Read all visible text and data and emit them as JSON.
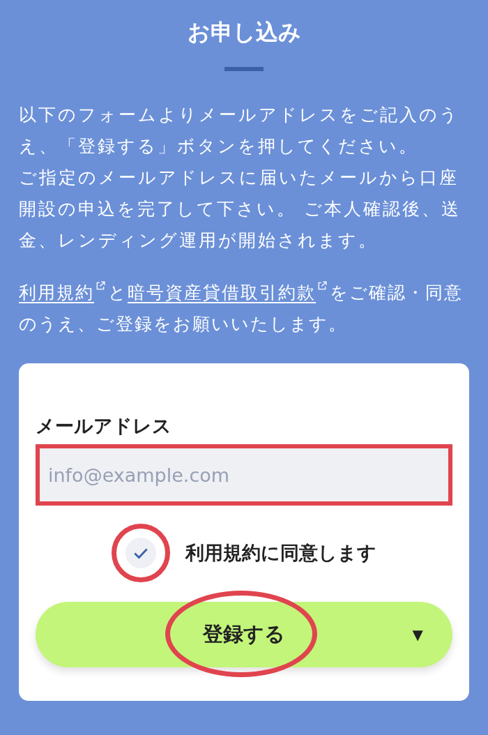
{
  "title": "お申し込み",
  "intro": [
    "以下のフォームよりメールアドレスをご記入のうえ、「登録する」ボタンを押してください。",
    "ご指定のメールアドレスに届いたメールから口座開設の申込を完了して下さい。 ご本人確認後、送金、レンディング運用が開始されます。"
  ],
  "terms": [
    {
      "kind": "link",
      "text": "利用規約"
    },
    {
      "kind": "text",
      "text": "と"
    },
    {
      "kind": "link",
      "text": "暗号資産貸借取引約款"
    },
    {
      "kind": "text",
      "text": "をご確認・同意のうえ、ご登録をお願いいたします。"
    }
  ],
  "form": {
    "email_label": "メールアドレス",
    "email_placeholder": "info@example.com",
    "agree": {
      "label": "利用規約に同意します",
      "checked": true
    },
    "submit": {
      "label": "登録する",
      "caret": "▼"
    }
  }
}
